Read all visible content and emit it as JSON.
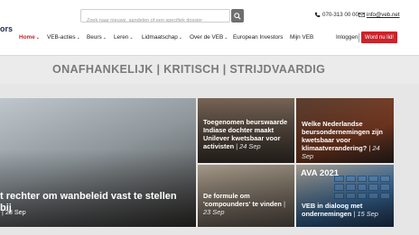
{
  "brand": {
    "logo_fragment": "ors"
  },
  "search": {
    "placeholder": "Zoek naar nieuws, aandelen of een specifiek dossier"
  },
  "contact": {
    "phone": "070-313 00 00",
    "email": "info@veb.net"
  },
  "nav": {
    "items": [
      {
        "label": "Home",
        "active": true,
        "dropdown": true
      },
      {
        "label": "VEB-acties",
        "dropdown": true
      },
      {
        "label": "Beurs",
        "dropdown": true
      },
      {
        "label": "Leren",
        "dropdown": true
      },
      {
        "label": "Lidmaatschap",
        "dropdown": true
      },
      {
        "label": "Over de VEB",
        "dropdown": true
      },
      {
        "label": "European Investors",
        "dropdown": false
      },
      {
        "label": "Mijn VEB",
        "dropdown": false
      }
    ],
    "login": "Inloggen",
    "join": "Word nu lid!"
  },
  "banner": {
    "tagline": "ONAFHANKELIJK | KRITISCH | STRIJDVAARDIG"
  },
  "tiles": {
    "hero": {
      "title": "t rechter om wanbeleid vast te stellen bij",
      "date": "| 28 Sep"
    },
    "t1": {
      "title": "Toegenomen beurswaarde Indiase dochter maakt Unilever kwetsbaar voor activisten",
      "date": "| 24 Sep"
    },
    "t2": {
      "title": "Welke Nederlandse beursondernemingen zijn kwetsbaar voor klimaatverandering?",
      "date": "| 24 Sep"
    },
    "t3": {
      "title": "De formule om 'compounders' te vinden",
      "date": "| 23 Sep"
    },
    "t4": {
      "label": "AVA 2021",
      "title": "VEB in dialoog met ondernemingen",
      "date": "| 15 Sep"
    }
  },
  "colors": {
    "accent": "#c9252c",
    "dark": "#1b2a4a",
    "banner_bg": "#ebebeb"
  }
}
